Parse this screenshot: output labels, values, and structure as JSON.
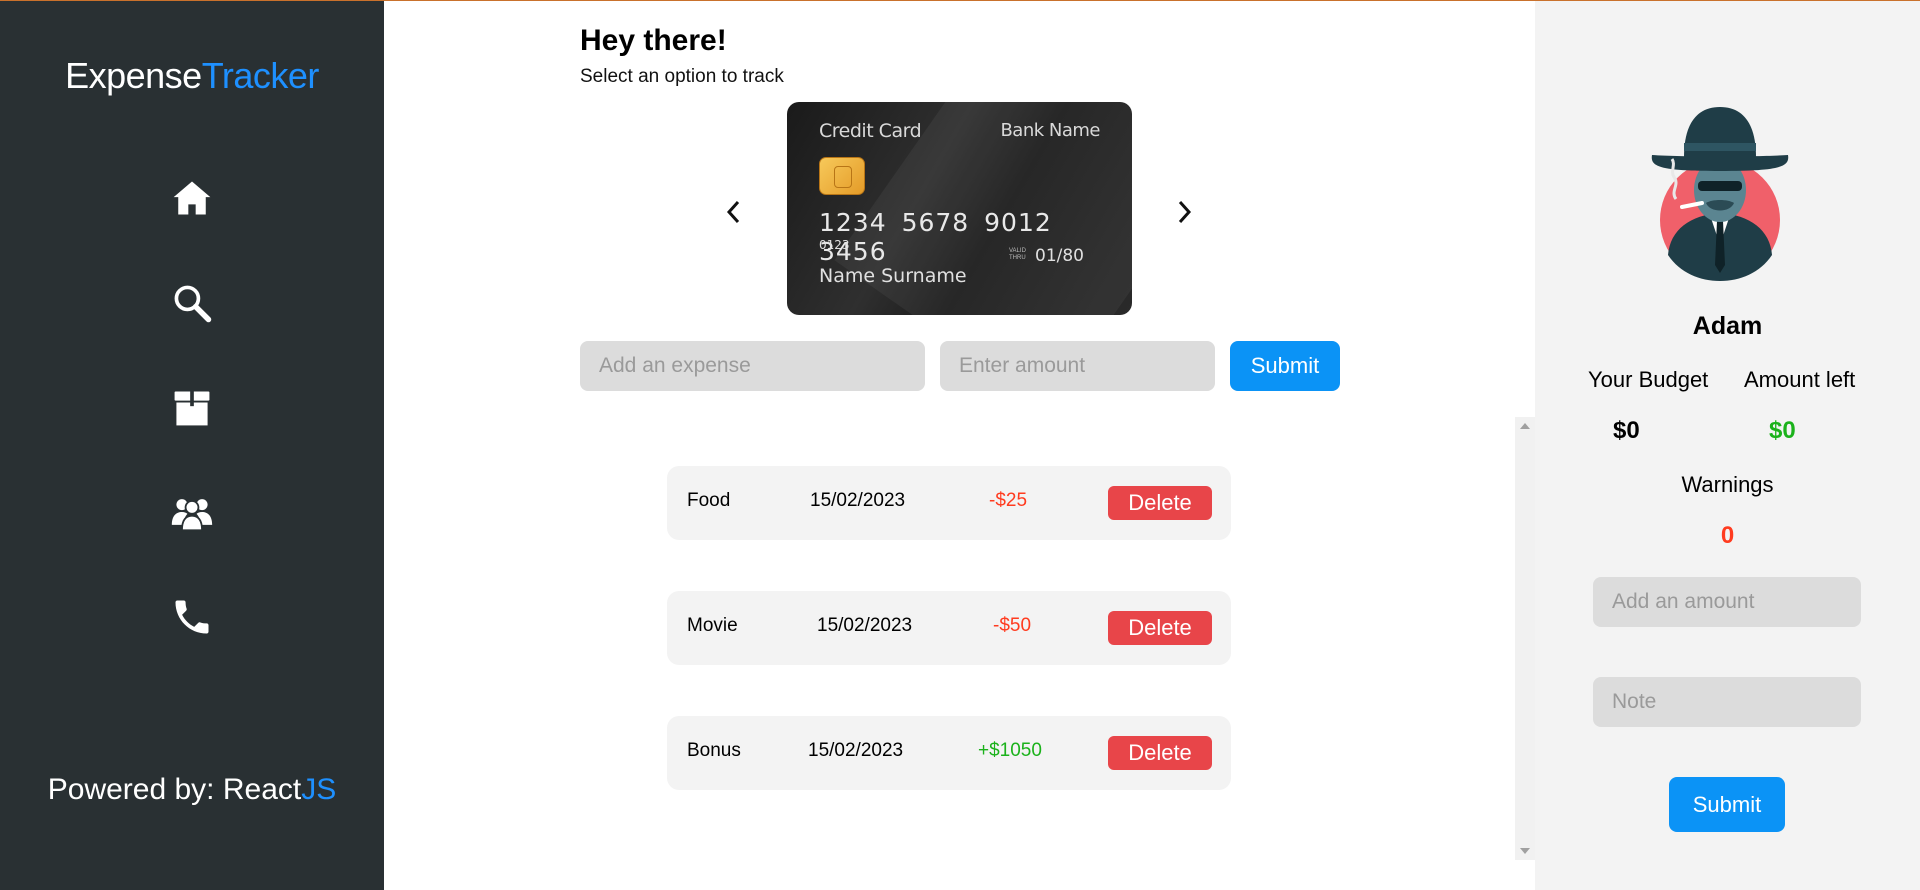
{
  "app": {
    "brand_part1": "Expense",
    "brand_part2": "Tracker",
    "powered_prefix": "Powered by: React",
    "powered_accent": "JS"
  },
  "sidebar": {
    "items": [
      {
        "icon": "home-icon"
      },
      {
        "icon": "search-icon"
      },
      {
        "icon": "box-icon"
      },
      {
        "icon": "users-icon"
      },
      {
        "icon": "phone-icon"
      }
    ]
  },
  "main": {
    "greeting": "Hey there!",
    "subtitle": "Select an option to track",
    "card": {
      "type": "Credit Card",
      "bank": "Bank Name",
      "number": "1234 5678 9012 3456",
      "small_number": "0123",
      "valid_label": "VALID THRU",
      "valid": "01/80",
      "holder": "Name Surname"
    },
    "expense_placeholder": "Add an expense",
    "amount_placeholder": "Enter amount",
    "submit_label": "Submit",
    "delete_label": "Delete",
    "transactions": [
      {
        "desc": "Food",
        "date": "15/02/2023",
        "amount": "-$25",
        "sign": "neg"
      },
      {
        "desc": "Movie",
        "date": "15/02/2023",
        "amount": "-$50",
        "sign": "neg"
      },
      {
        "desc": "Bonus",
        "date": "15/02/2023",
        "amount": "+$1050",
        "sign": "pos"
      }
    ]
  },
  "panel": {
    "name": "Adam",
    "budget_label": "Your Budget",
    "budget_value": "$0",
    "left_label": "Amount left",
    "left_value": "$0",
    "warnings_label": "Warnings",
    "warnings_value": "0",
    "amount_placeholder": "Add an amount",
    "note_placeholder": "Note",
    "submit_label": "Submit"
  },
  "colors": {
    "sidebar_bg": "#293033",
    "accent": "#1e90ff",
    "primary_button": "#0b93f6",
    "delete_button": "#e84549",
    "negative": "#ff3b1f",
    "positive": "#1bb21b"
  }
}
